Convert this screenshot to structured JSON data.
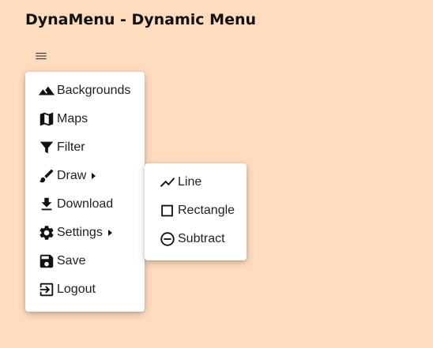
{
  "title": "DynaMenu - Dynamic Menu",
  "colors": {
    "background": "#ffdcbd",
    "menu_bg": "#ffffff",
    "text": "#1f1f1f"
  },
  "main_menu": {
    "items": [
      {
        "label": "Backgrounds",
        "icon": "terrain-icon"
      },
      {
        "label": "Maps",
        "icon": "map-icon"
      },
      {
        "label": "Filter",
        "icon": "filter-icon"
      },
      {
        "label": "Draw",
        "icon": "brush-icon",
        "has_submenu": true
      },
      {
        "label": "Download",
        "icon": "download-icon"
      },
      {
        "label": "Settings",
        "icon": "gear-icon",
        "has_submenu": true
      },
      {
        "label": "Save",
        "icon": "save-icon"
      },
      {
        "label": "Logout",
        "icon": "logout-icon"
      }
    ]
  },
  "submenu": {
    "parent": "Draw",
    "items": [
      {
        "label": "Line",
        "icon": "line-chart-icon"
      },
      {
        "label": "Rectangle",
        "icon": "square-outline-icon"
      },
      {
        "label": "Subtract",
        "icon": "minus-circle-icon"
      }
    ]
  }
}
